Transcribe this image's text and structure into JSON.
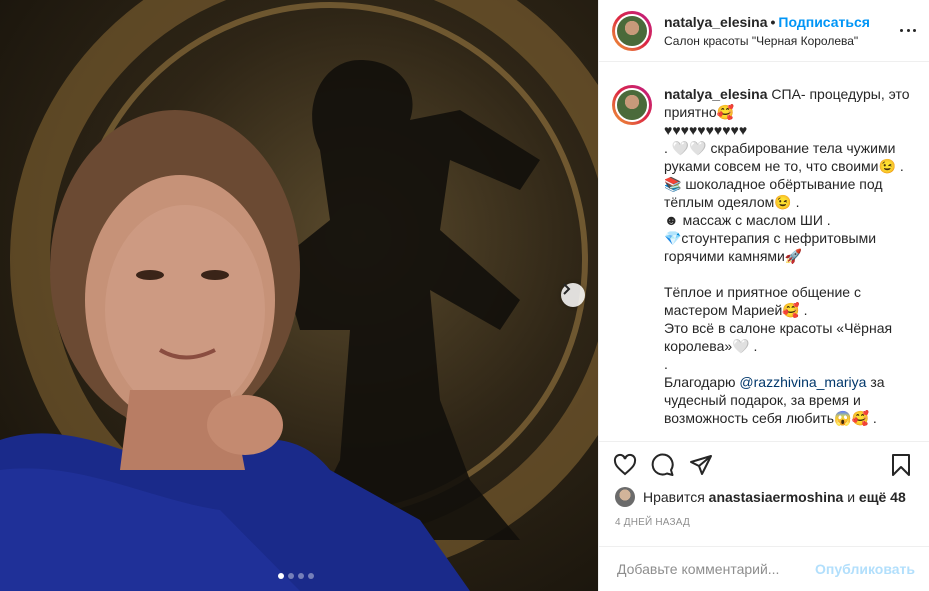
{
  "post": {
    "username": "natalya_elesina",
    "separator": "•",
    "follow_label": "Подписаться",
    "location": "Салон красоты \"Черная Королева\"",
    "photo_dots_total": 4,
    "photo_dots_active": 1
  },
  "caption": {
    "username": "natalya_elesina",
    "first_line": "СПА- процедуры, это приятно🥰",
    "lines": [
      "♥♥♥♥♥♥♥♥♥♥",
      ". 🤍🤍 скрабирование тела чужими руками совсем не то, что своими😉 .",
      "📚 шоколадное обёртывание под тёплым одеялом😉 .",
      "☻ массаж с маслом ШИ .",
      "💎стоунтерапия с нефритовыми горячими камнями🚀"
    ],
    "lines2": [
      "Тёплое и приятное общение с мастером Марией🥰 .",
      "Это всё в салоне красоты «Чёрная королева»🤍 .",
      "."
    ],
    "thanks_prefix": "Благодарю ",
    "mention": "@razzhivina_mariya",
    "thanks_suffix": " за чудесный подарок, за время и возможность себя любить😱🥰 ."
  },
  "likes": {
    "prefix": "Нравится ",
    "user": "anastasiaermoshina",
    "middle": " и ",
    "rest": "ещё 48"
  },
  "date": "4 ДНЕЙ НАЗАД",
  "comment": {
    "placeholder": "Добавьте комментарий...",
    "publish_label": "Опубликовать"
  }
}
